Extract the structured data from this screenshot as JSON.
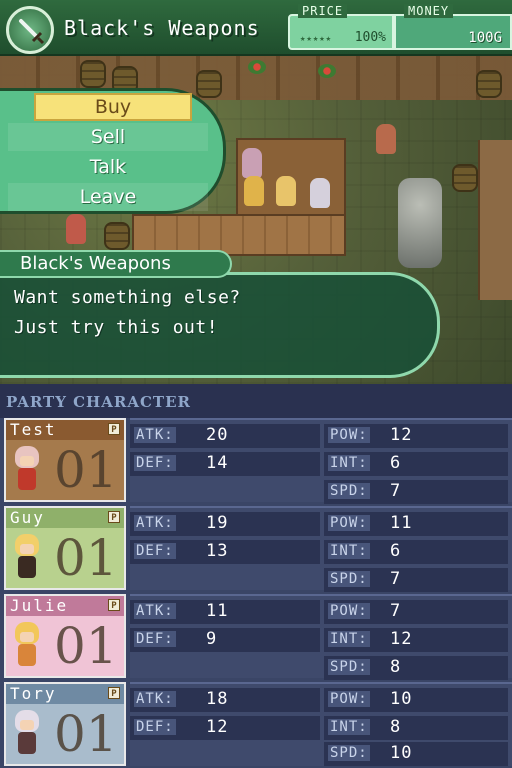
{
  "shop": {
    "title": "Black's Weapons",
    "icon": "sword-icon",
    "price_label": "PRICE",
    "price_value": "100%",
    "price_stars": "★★★★★",
    "money_label": "MONEY",
    "money_value": "100G"
  },
  "menu": {
    "items": [
      {
        "label": "Buy",
        "selected": true
      },
      {
        "label": "Sell",
        "selected": false
      },
      {
        "label": "Talk",
        "selected": false
      },
      {
        "label": "Leave",
        "selected": false
      }
    ]
  },
  "dialog": {
    "speaker": "Black's Weapons",
    "lines": [
      "Want something else?",
      "Just try this out!"
    ]
  },
  "party": {
    "header": "PARTY CHARACTER",
    "members": [
      {
        "name": "Test",
        "level": "01",
        "badge": "P",
        "color": "#9a6a3f",
        "atk_label": "ATK:",
        "atk": "20",
        "def_label": "DEF:",
        "def": "14",
        "pow_label": "POW:",
        "pow": "12",
        "int_label": "INT:",
        "int": "6",
        "spd_label": "SPD:",
        "spd": "7"
      },
      {
        "name": "Guy",
        "level": "01",
        "badge": "P",
        "color": "#8fb06a",
        "atk_label": "ATK:",
        "atk": "19",
        "def_label": "DEF:",
        "def": "13",
        "pow_label": "POW:",
        "pow": "11",
        "int_label": "INT:",
        "int": "6",
        "spd_label": "SPD:",
        "spd": "7"
      },
      {
        "name": "Julie",
        "level": "01",
        "badge": "P",
        "color": "#c07a9a",
        "atk_label": "ATK:",
        "atk": "11",
        "def_label": "DEF:",
        "def": "9",
        "pow_label": "POW:",
        "pow": "7",
        "int_label": "INT:",
        "int": "12",
        "spd_label": "SPD:",
        "spd": "8"
      },
      {
        "name": "Tory",
        "level": "01",
        "badge": "P",
        "color": "#6f8aa3",
        "atk_label": "ATK:",
        "atk": "18",
        "def_label": "DEF:",
        "def": "12",
        "pow_label": "POW:",
        "pow": "10",
        "int_label": "INT:",
        "int": "8",
        "spd_label": "SPD:",
        "spd": "10"
      }
    ]
  }
}
